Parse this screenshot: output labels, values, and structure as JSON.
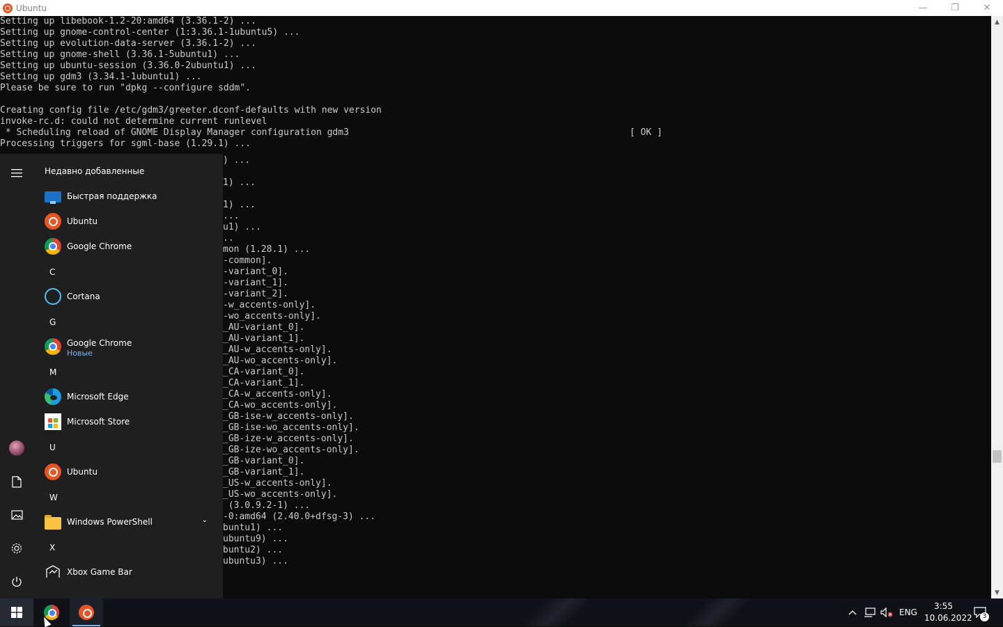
{
  "window": {
    "title": "Ubuntu",
    "minimize_glyph": "—",
    "restore_glyph": "❐",
    "close_glyph": "✕"
  },
  "terminal": {
    "top_block": "Setting up libebook-1.2-20:amd64 (3.36.1-2) ...\nSetting up gnome-control-center (1:3.36.1-1ubuntu5) ...\nSetting up evolution-data-server (3.36.1-2) ...\nSetting up gnome-shell (3.36.1-5ubuntu1) ...\nSetting up ubuntu-session (3.36.0-2ubuntu1) ...\nSetting up gdm3 (3.34.1-1ubuntu1) ...\nPlease be sure to run \"dpkg --configure sddm\".\n\nCreating config file /etc/gdm3/greeter.dconf-defaults with new version\ninvoke-rc.d: could not determine current runlevel\n * Scheduling reload of GNOME Display Manager configuration gdm3\nProcessing triggers for sgml-base (1.29.1) ...",
    "ok_status": "[ OK ]",
    "partial_block": ") ...\n\n1) ...\n\n1) ...\n...\nu1) ...\n..\nmon (1.28.1) ...\n-common].\n-variant_0].\n-variant_1].\n-variant_2].\n-w_accents-only].\n-wo_accents-only].\n_AU-variant_0].\n_AU-variant_1].\n_AU-w_accents-only].\n_AU-wo_accents-only].\n_CA-variant_0].\n_CA-variant_1].\n_CA-w_accents-only].\n_CA-wo_accents-only].\n_GB-ise-w_accents-only].\n_GB-ise-wo_accents-only].\n_GB-ize-w_accents-only].\n_GB-ize-wo_accents-only].\n_GB-variant_0].\n_GB-variant_1].\n_US-w_accents-only].\n_US-wo_accents-only].\n (3.0.9.2-1) ...\n-0:amd64 (2.40.0+dfsg-3) ...\nbuntu1) ...\nubuntu9) ...\nbuntu2) ...\nubuntu3) ..."
  },
  "start_menu": {
    "header": "Недавно добавленные",
    "recent": [
      {
        "label": "Быстрая поддержка",
        "icon": "quick-assist-icon"
      },
      {
        "label": "Ubuntu",
        "icon": "ubuntu-icon"
      },
      {
        "label": "Google Chrome",
        "icon": "chrome-icon"
      }
    ],
    "letters": {
      "c": "C",
      "g": "G",
      "m": "M",
      "u": "U",
      "w": "W",
      "x": "X"
    },
    "apps": {
      "cortana": "Cortana",
      "chrome": "Google Chrome",
      "chrome_sub": "Новые",
      "edge": "Microsoft Edge",
      "store": "Microsoft Store",
      "ubuntu": "Ubuntu",
      "powershell": "Windows PowerShell",
      "xbox": "Xbox Game Bar"
    },
    "rail_icons": [
      "hamburger-icon",
      "avatar",
      "document-icon",
      "pictures-icon",
      "settings-icon",
      "power-icon"
    ]
  },
  "taskbar": {
    "language": "ENG",
    "time": "3:55",
    "date": "10.06.2022",
    "notification_count": "3"
  },
  "colors": {
    "terminal_bg": "#0c0c0c",
    "terminal_fg": "#cccccc",
    "start_bg": "#1f1f1f",
    "ubuntu_orange": "#e95420",
    "accent": "#76b9ed"
  }
}
